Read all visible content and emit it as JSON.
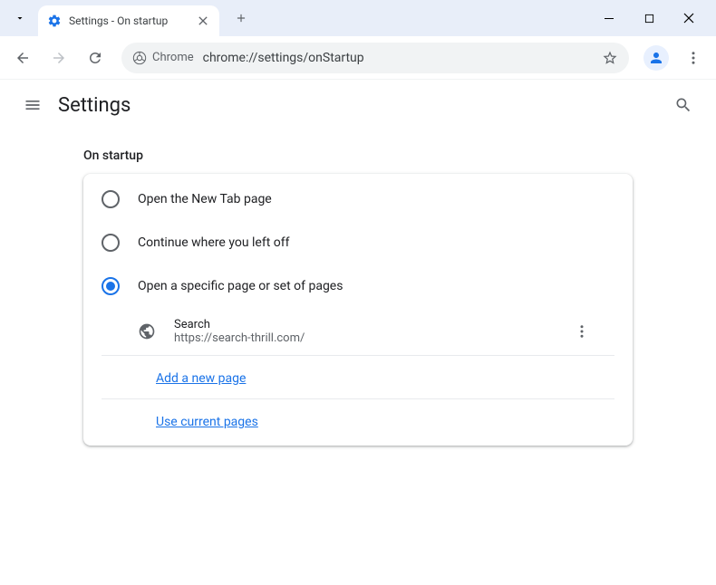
{
  "titlebar": {
    "tab_title": "Settings - On startup"
  },
  "toolbar": {
    "chrome_label": "Chrome",
    "url": "chrome://settings/onStartup"
  },
  "header": {
    "title": "Settings"
  },
  "section": {
    "title": "On startup",
    "options": [
      {
        "label": "Open the New Tab page",
        "selected": false
      },
      {
        "label": "Continue where you left off",
        "selected": false
      },
      {
        "label": "Open a specific page or set of pages",
        "selected": true
      }
    ],
    "pages": [
      {
        "title": "Search",
        "url": "https://search-thrill.com/"
      }
    ],
    "add_page": "Add a new page",
    "use_current": "Use current pages"
  }
}
